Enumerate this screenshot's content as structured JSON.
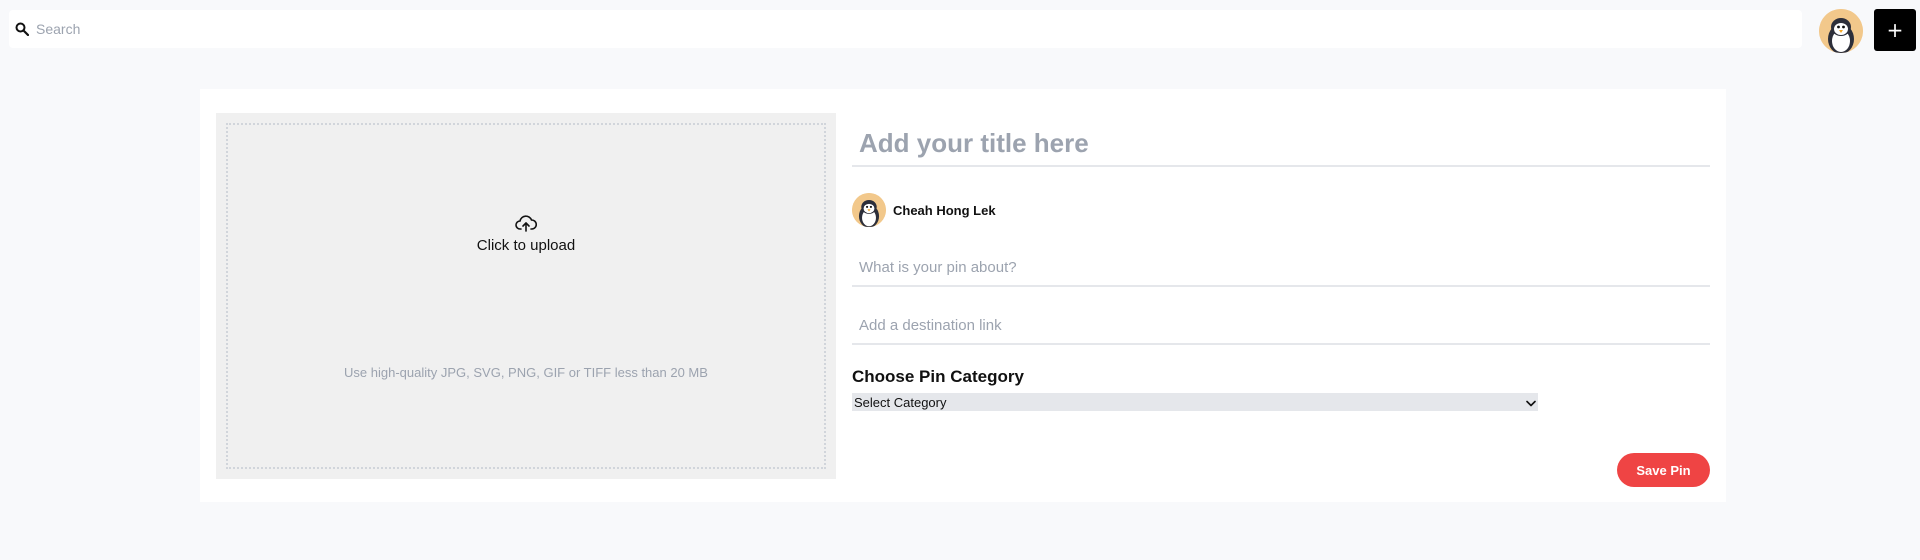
{
  "search": {
    "placeholder": "Search",
    "value": ""
  },
  "header": {
    "add_label": "+",
    "icons": {
      "search": "search-icon",
      "avatar": "penguin-avatar-icon"
    }
  },
  "upload": {
    "icon": "cloud-upload-icon",
    "label": "Click to upload",
    "hint": "Use high-quality JPG, SVG, PNG, GIF or TIFF less than 20 MB"
  },
  "form": {
    "title_placeholder": "Add your title here",
    "author_name": "Cheah Hong Lek",
    "about_placeholder": "What is your pin about?",
    "link_placeholder": "Add a destination link",
    "category_heading": "Choose Pin Category",
    "category_selected": "Select Category",
    "save_label": "Save Pin"
  },
  "colors": {
    "accent": "#ef4444",
    "page_background": "#f8f9fb",
    "upload_background": "#f0f0f0",
    "placeholder": "#9ca3af"
  }
}
